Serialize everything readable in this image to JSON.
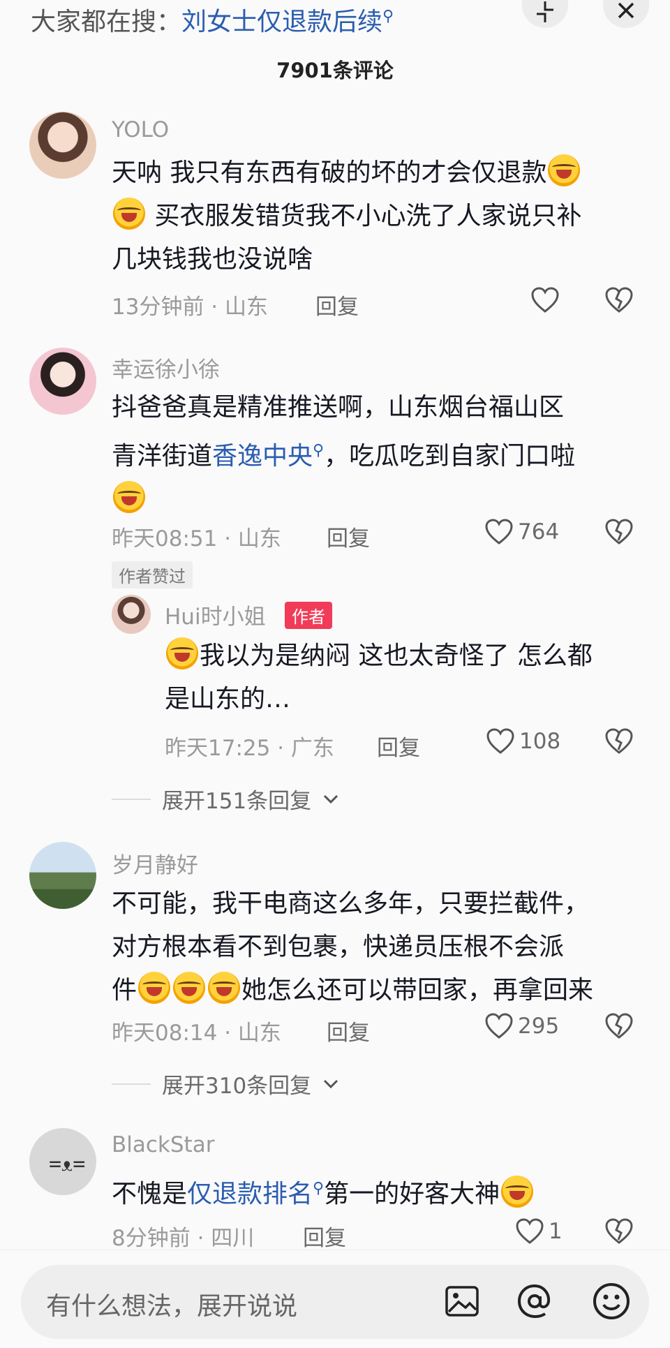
{
  "header": {
    "search_prefix": "大家都在搜：",
    "search_link": "刘女士仅退款后续",
    "comment_count": "7901条评论"
  },
  "comments": [
    {
      "username": "YOLO",
      "line1": "天呐 我只有东西有破的坏的才会仅退款",
      "line2": " 买衣服发错货我不小心洗了人家说只补",
      "line3": "几块钱我也没说啥",
      "time_location": "13分钟前 · 山东",
      "reply_label": "回复",
      "likes": ""
    },
    {
      "username": "幸运徐小徐",
      "line1": "抖爸爸真是精准推送啊，山东烟台福山区",
      "line2_pre": "青洋街道",
      "line2_link": "香逸中央",
      "line2_post": "，吃瓜吃到自家门口啦",
      "time_location": "昨天08:51 · 山东",
      "reply_label": "回复",
      "likes": "764",
      "author_liked_tag": "作者赞过",
      "sub_reply": {
        "username": "Hui时小姐",
        "author_tag": "作者",
        "line1": "我以为是纳闷 这也太奇怪了 怎么都",
        "line2": "是山东的…",
        "time_location": "昨天17:25 · 广东",
        "reply_label": "回复",
        "likes": "108"
      },
      "expand_label": "展开151条回复"
    },
    {
      "username": "岁月静好",
      "line1": "不可能，我干电商这么多年，只要拦截件，",
      "line2": "对方根本看不到包裹，快递员压根不会派",
      "line3_pre": "件",
      "line3_post": "她怎么还可以带回家，再拿回来",
      "time_location": "昨天08:14 · 山东",
      "reply_label": "回复",
      "likes": "295",
      "expand_label": "展开310条回复"
    },
    {
      "username": "BlackStar",
      "line1_pre": "不愧是",
      "line1_link": "仅退款排名",
      "line1_post": "第一的好客大神",
      "time_location": "8分钟前 · 四川",
      "reply_label": "回复",
      "likes": "1"
    }
  ],
  "input": {
    "placeholder": "有什么想法，展开说说"
  },
  "icons": {
    "search_suggestion": "search-icon",
    "top_left_button": "shrink-icon",
    "top_right_button": "close-icon",
    "like": "heart-icon",
    "dislike": "broken-heart-icon",
    "image": "image-icon",
    "mention": "at-icon",
    "emoji": "emoji-icon"
  },
  "colors": {
    "link": "#2a5db0",
    "author_tag": "#f13b58",
    "secondary_text": "#9a9a9a"
  }
}
